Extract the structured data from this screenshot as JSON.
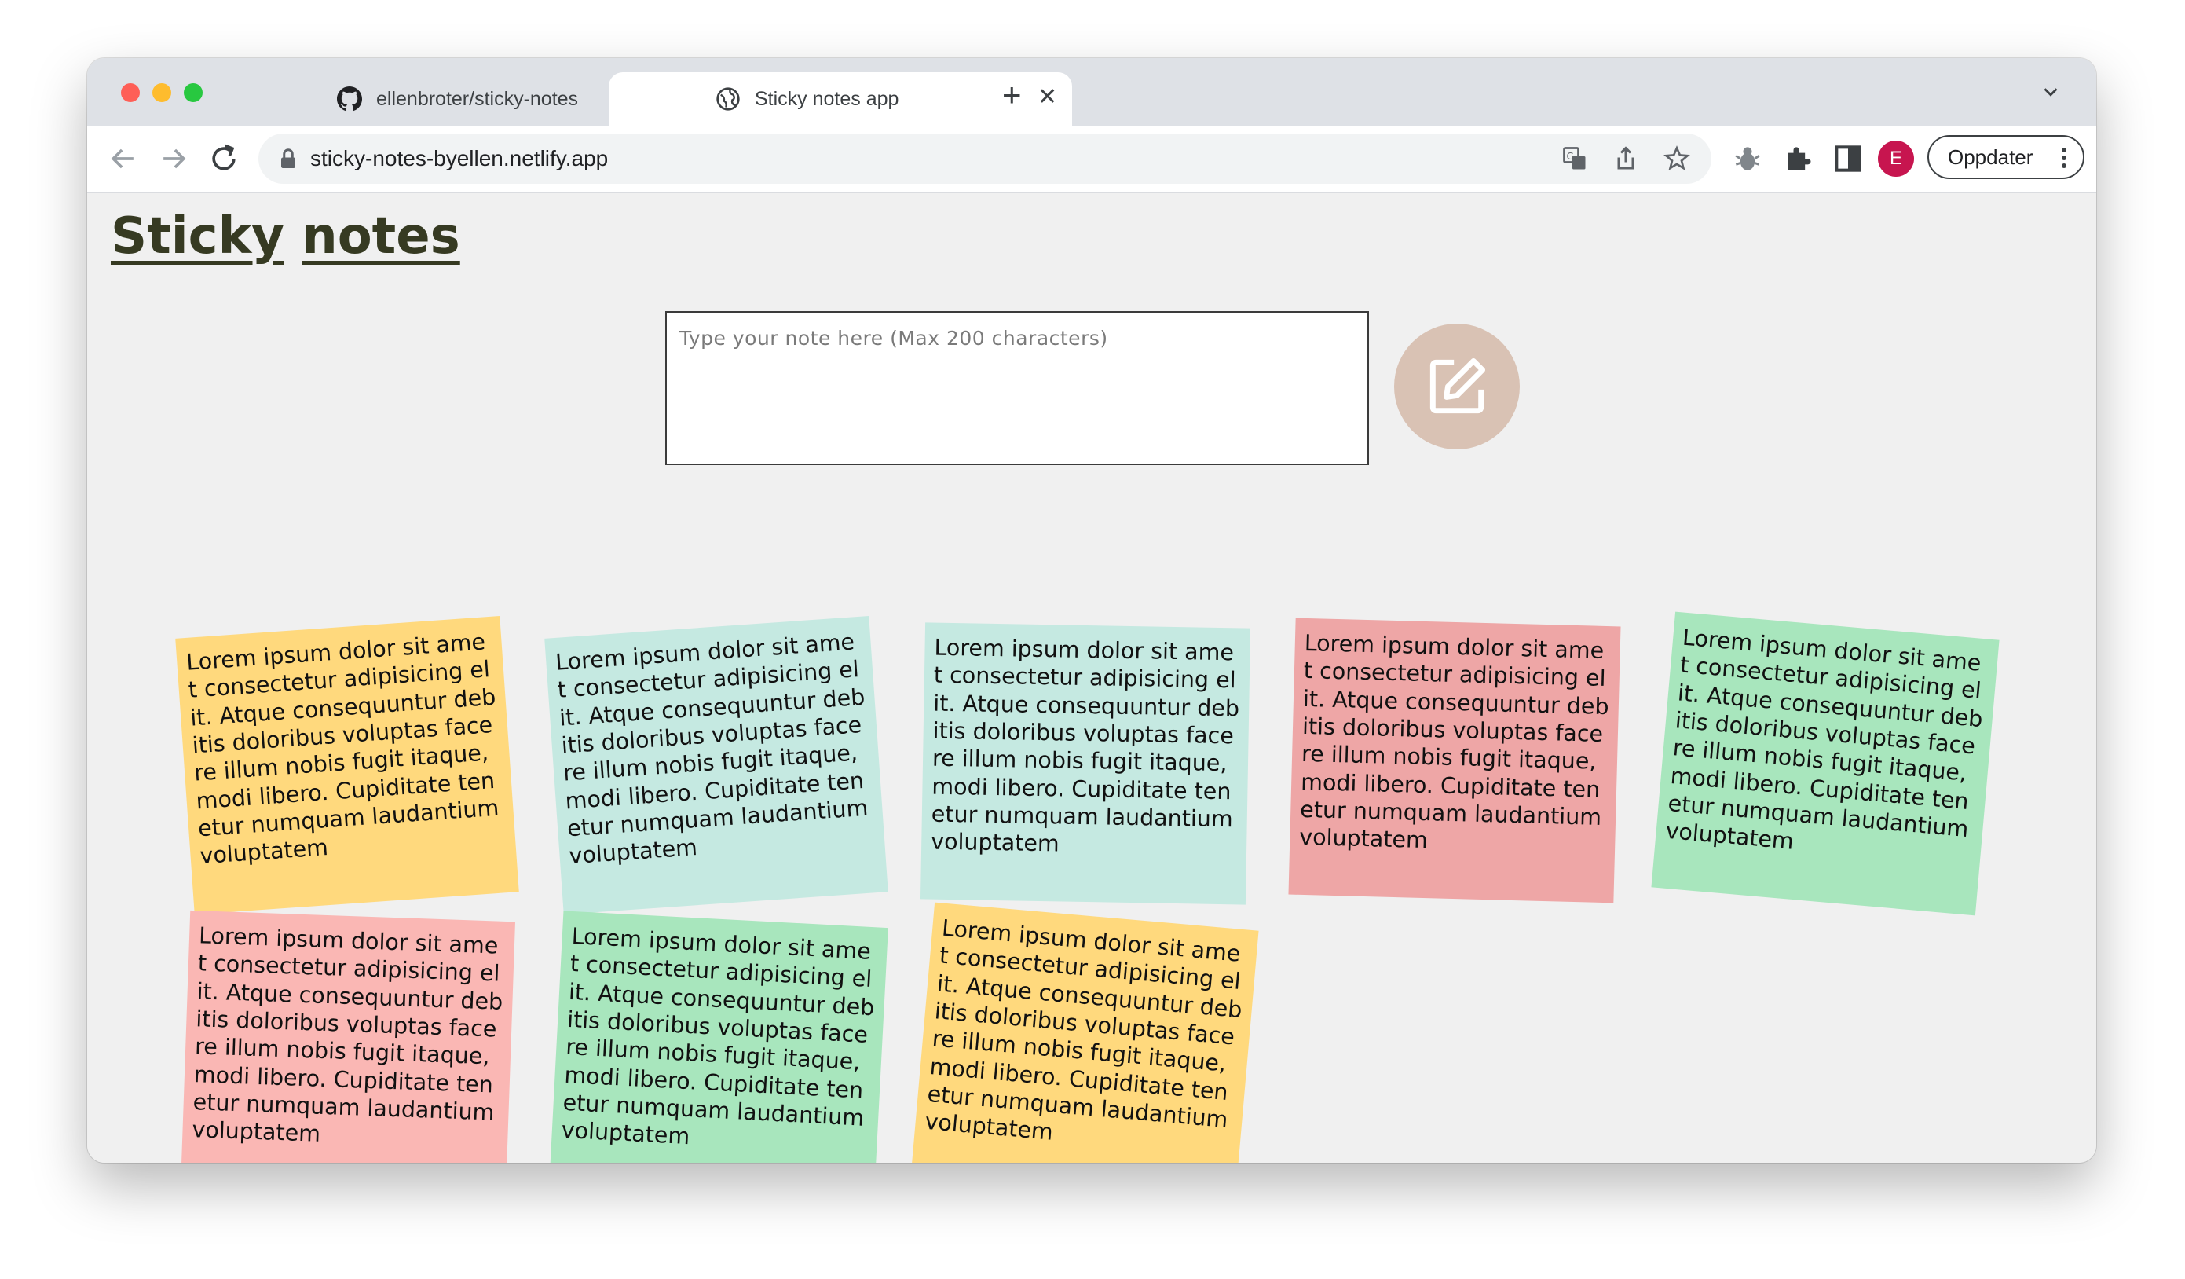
{
  "browser": {
    "tabs": [
      {
        "label": "ellenbroter/sticky-notes",
        "active": false,
        "icon": "github-icon"
      },
      {
        "label": "Sticky notes app",
        "active": true,
        "icon": "globe-icon"
      }
    ],
    "url": "sticky-notes-byellen.netlify.app",
    "profile_initial": "E",
    "update_label": "Oppdater"
  },
  "page": {
    "title_word_1": "Sticky",
    "title_word_2": "notes",
    "note_placeholder": "Type your note here (Max 200 characters)",
    "add_button_icon": "edit-note-icon"
  },
  "colors": {
    "yellow": "#ffd97d",
    "teal": "#c5e9e1",
    "red": "#eea6a6",
    "pink": "#fab7b4",
    "green": "#a8e6bd",
    "title": "#363a22",
    "add_button": "#d9c2b4"
  },
  "notes": [
    {
      "text": "Lorem ipsum dolor sit amet consectetur adipisicing elit. Atque consequuntur debitis doloribus voluptas facere illum nobis fugit itaque, modi libero. Cupiditate tenetur numquam laudantium voluptatem",
      "color": "yellow"
    },
    {
      "text": "Lorem ipsum dolor sit amet consectetur adipisicing elit. Atque consequuntur debitis doloribus voluptas facere illum nobis fugit itaque, modi libero. Cupiditate tenetur numquam laudantium voluptatem",
      "color": "teal"
    },
    {
      "text": "Lorem ipsum dolor sit amet consectetur adipisicing elit. Atque consequuntur debitis doloribus voluptas facere illum nobis fugit itaque, modi libero. Cupiditate tenetur numquam laudantium voluptatem",
      "color": "teal"
    },
    {
      "text": "Lorem ipsum dolor sit amet consectetur adipisicing elit. Atque consequuntur debitis doloribus voluptas facere illum nobis fugit itaque, modi libero. Cupiditate tenetur numquam laudantium voluptatem",
      "color": "red"
    },
    {
      "text": "Lorem ipsum dolor sit amet consectetur adipisicing elit. Atque consequuntur debitis doloribus voluptas facere illum nobis fugit itaque, modi libero. Cupiditate tenetur numquam laudantium voluptatem",
      "color": "green"
    },
    {
      "text": "Lorem ipsum dolor sit amet consectetur adipisicing elit. Atque consequuntur debitis doloribus voluptas facere illum nobis fugit itaque, modi libero. Cupiditate tenetur numquam laudantium voluptatem",
      "color": "pink"
    },
    {
      "text": "Lorem ipsum dolor sit amet consectetur adipisicing elit. Atque consequuntur debitis doloribus voluptas facere illum nobis fugit itaque, modi libero. Cupiditate tenetur numquam laudantium voluptatem",
      "color": "green"
    },
    {
      "text": "Lorem ipsum dolor sit amet consectetur adipisicing elit. Atque consequuntur debitis doloribus voluptas facere illum nobis fugit itaque, modi libero. Cupiditate tenetur numquam laudantium voluptatem",
      "color": "yellow"
    }
  ]
}
